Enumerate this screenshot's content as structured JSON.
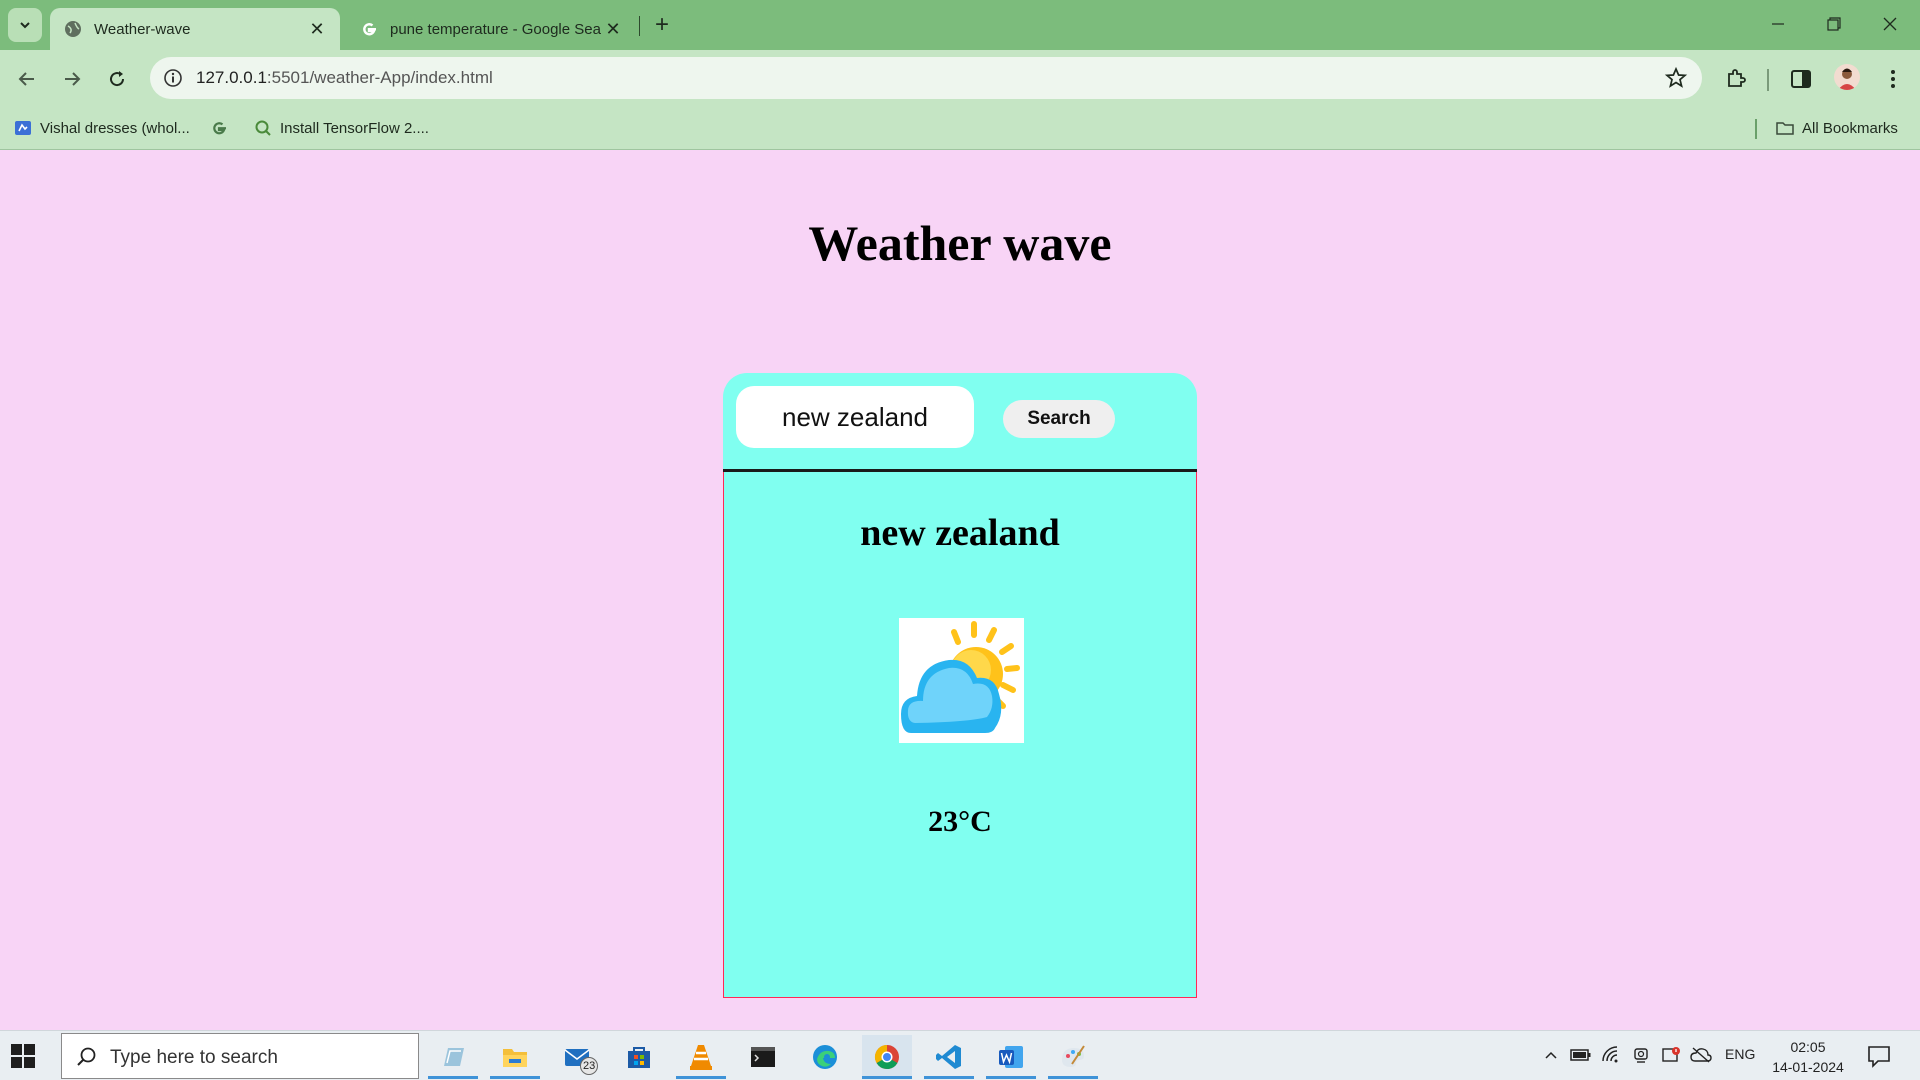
{
  "browser": {
    "tabs": [
      {
        "title": "Weather-wave",
        "favicon": "globe-icon",
        "active": true
      },
      {
        "title": "pune temperature - Google Sear",
        "favicon": "google-icon",
        "active": false
      }
    ],
    "url_host": "127.0.0.1",
    "url_path": ":5501/weather-App/index.html",
    "bookmarks": [
      {
        "label": "Vishal dresses (whol...",
        "icon": "maps-icon"
      },
      {
        "label": "",
        "icon": "google-icon"
      },
      {
        "label": "Install TensorFlow 2....",
        "icon": "search-icon"
      }
    ],
    "all_bookmarks_label": "All Bookmarks"
  },
  "page": {
    "title": "Weather wave",
    "search_value": "new zealand",
    "search_button": "Search",
    "city": "new zealand",
    "weather_icon": "partly-cloudy-icon",
    "temperature": "23°C"
  },
  "taskbar": {
    "search_placeholder": "Type here to search",
    "mail_badge": "23",
    "language": "ENG",
    "time": "02:05",
    "date": "14-01-2024"
  },
  "colors": {
    "page_bg": "#f8d4f6",
    "card_bg": "#80fff0",
    "chrome_tabbar": "#7cbc7c",
    "chrome_toolbar": "#c5e5c4"
  }
}
